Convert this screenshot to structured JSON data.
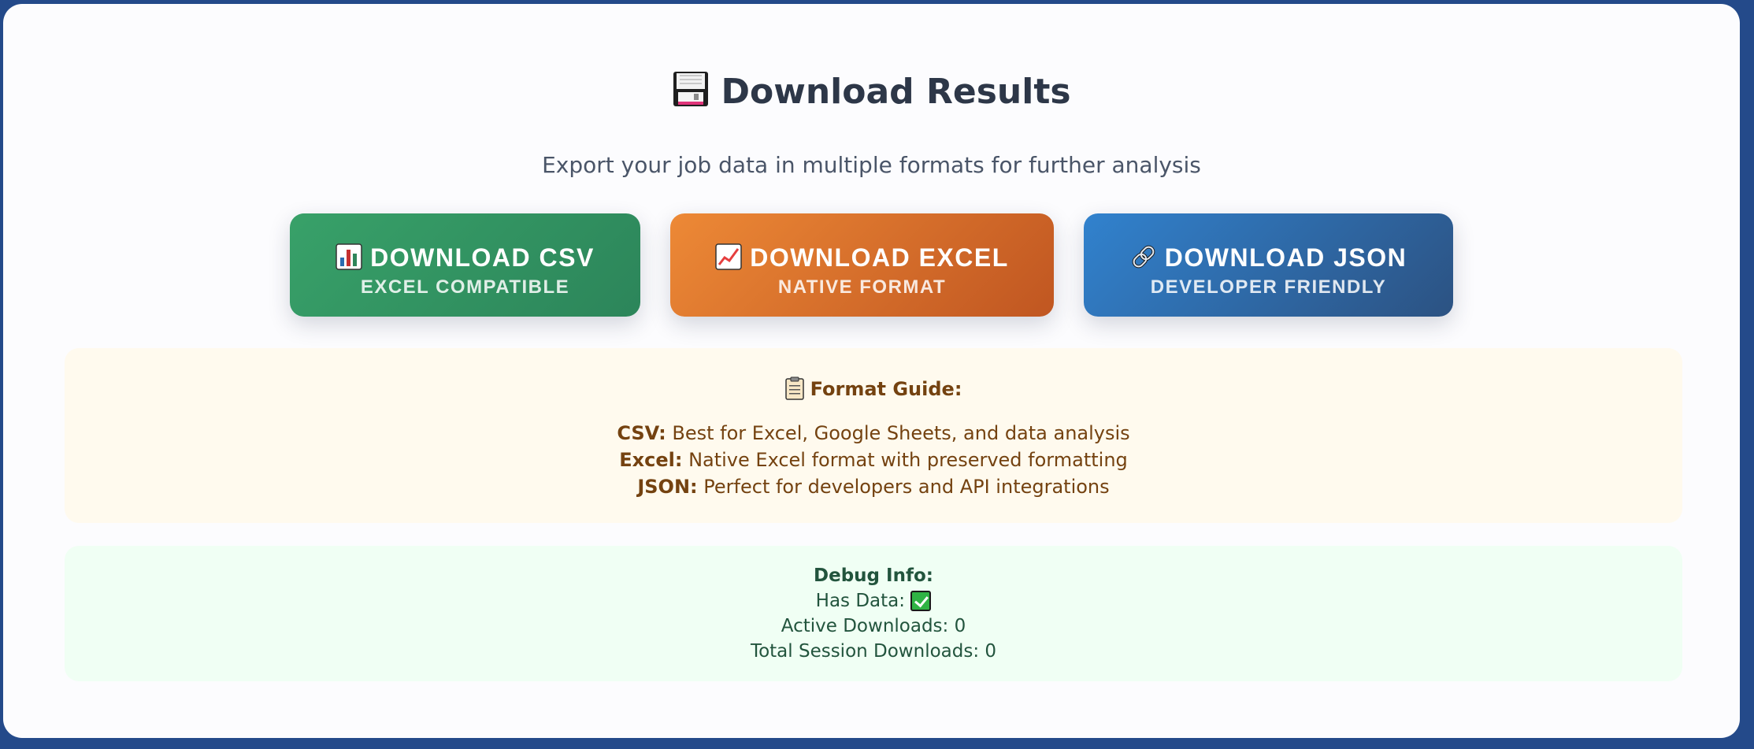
{
  "header": {
    "icon": "floppy-disk-icon",
    "title": "Download Results",
    "subtitle": "Export your job data in multiple formats for further analysis"
  },
  "buttons": [
    {
      "icon": "bar-chart-icon",
      "label": "DOWNLOAD CSV",
      "sublabel": "EXCEL COMPATIBLE",
      "color": "#38a169"
    },
    {
      "icon": "line-chart-icon",
      "label": "DOWNLOAD EXCEL",
      "sublabel": "NATIVE FORMAT",
      "color": "#ed8936"
    },
    {
      "icon": "link-icon",
      "label": "DOWNLOAD JSON",
      "sublabel": "DEVELOPER FRIENDLY",
      "color": "#3182ce"
    }
  ],
  "guide": {
    "icon": "clipboard-icon",
    "title": "Format Guide:",
    "items": [
      {
        "format": "CSV:",
        "description": "Best for Excel, Google Sheets, and data analysis"
      },
      {
        "format": "Excel:",
        "description": "Native Excel format with preserved formatting"
      },
      {
        "format": "JSON:",
        "description": "Perfect for developers and API integrations"
      }
    ]
  },
  "debug": {
    "title": "Debug Info:",
    "has_data_label": "Has Data:",
    "has_data_icon": "check-mark-icon",
    "active_downloads": "Active Downloads: 0",
    "total_downloads": "Total Session Downloads: 0"
  }
}
